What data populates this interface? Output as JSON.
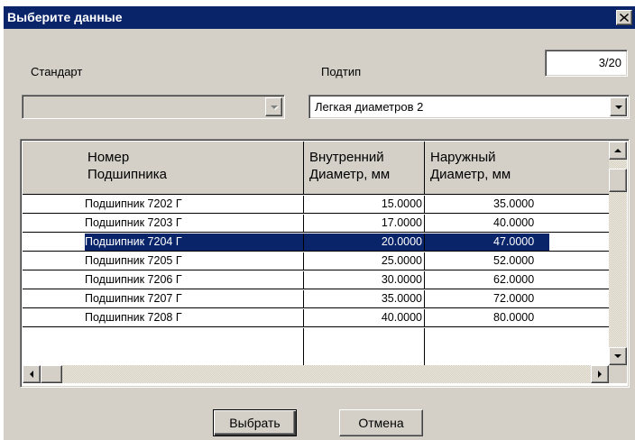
{
  "window": {
    "title": "Выберите данные",
    "close_glyph": "✕"
  },
  "form": {
    "standard_label": "Стандарт",
    "standard_value": "",
    "subtype_label": "Подтип",
    "subtype_value": "Легкая диаметров 2",
    "counter": "3/20"
  },
  "table": {
    "columns": [
      "Номер\nПодшипника",
      "Внутренний\nДиаметр, мм",
      "Наружный\nДиаметр, мм"
    ],
    "rows": [
      [
        "Подшипник 7202 Г",
        "15.0000",
        "35.0000"
      ],
      [
        "Подшипник 7203 Г",
        "17.0000",
        "40.0000"
      ],
      [
        "Подшипник 7204 Г",
        "20.0000",
        "47.0000"
      ],
      [
        "Подшипник 7205 Г",
        "25.0000",
        "52.0000"
      ],
      [
        "Подшипник 7206 Г",
        "30.0000",
        "62.0000"
      ],
      [
        "Подшипник 7207 Г",
        "35.0000",
        "72.0000"
      ],
      [
        "Подшипник 7208 Г",
        "40.0000",
        "80.0000"
      ]
    ],
    "selected_row": 2
  },
  "buttons": {
    "select_label": "Выбрать",
    "cancel_label": "Отмена"
  },
  "colors": {
    "titlebar": "#0a246a",
    "face": "#d4d0c8",
    "selection": "#0a246a"
  },
  "icons": [
    "close-icon",
    "dropdown-arrow-icon",
    "scroll-up-icon",
    "scroll-down-icon",
    "scroll-left-icon",
    "scroll-right-icon"
  ]
}
